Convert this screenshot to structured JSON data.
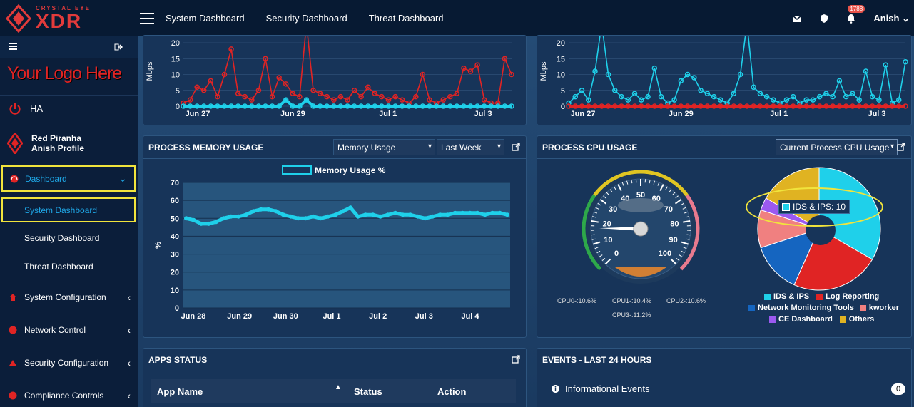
{
  "header": {
    "brand_small": "CRYSTAL EYE",
    "brand_big": "XDR",
    "nav": [
      "System Dashboard",
      "Security Dashboard",
      "Threat Dashboard"
    ],
    "notif_count": "1788",
    "user": "Anish"
  },
  "sidebar": {
    "logo_text": "Your Logo Here",
    "ha": "HA",
    "profile_name": "Red Piranha",
    "profile_sub": "Anish Profile",
    "items": [
      {
        "label": "Dashboard"
      },
      {
        "label": "System Dashboard"
      },
      {
        "label": "Security Dashboard"
      },
      {
        "label": "Threat Dashboard"
      },
      {
        "label": "System Configuration"
      },
      {
        "label": "Network Control"
      },
      {
        "label": "Security Configuration"
      },
      {
        "label": "Compliance Controls"
      }
    ]
  },
  "traffic_left": {
    "ylabel": "Mbps",
    "ticks": [
      "20",
      "15",
      "10",
      "5",
      "0"
    ],
    "xticks": [
      "Jun 27",
      "Jun 29",
      "Jul 1",
      "Jul 3"
    ]
  },
  "traffic_right": {
    "ylabel": "Mbps",
    "ticks": [
      "20",
      "15",
      "10",
      "5",
      "0"
    ],
    "xticks": [
      "Jun 27",
      "Jun 29",
      "Jul 1",
      "Jul 3"
    ]
  },
  "memory": {
    "title": "PROCESS MEMORY USAGE",
    "select1": "Memory Usage",
    "select2": "Last Week",
    "legend": "Memory Usage %"
  },
  "cpu": {
    "title": "PROCESS CPU USAGE",
    "select": "Current Process CPU Usage",
    "gauge_ticks": [
      "0",
      "10",
      "20",
      "30",
      "40",
      "50",
      "60",
      "70",
      "80",
      "90",
      "100"
    ],
    "gauge_value": 17,
    "cores": [
      "CPU0-:10.6%",
      "CPU1-:10.4%",
      "CPU2-:10.6%",
      "CPU3-:11.2%"
    ],
    "tooltip": "IDS & IPS: 10",
    "legend": [
      {
        "name": "IDS & IPS",
        "color": "#1fd0ea"
      },
      {
        "name": "Log Reporting",
        "color": "#e02424"
      },
      {
        "name": "Network Monitoring Tools",
        "color": "#1565c0"
      },
      {
        "name": "kworker",
        "color": "#f08080"
      },
      {
        "name": "CE Dashboard",
        "color": "#9b59f0"
      },
      {
        "name": "Others",
        "color": "#e0b322"
      }
    ]
  },
  "apps": {
    "title": "APPS STATUS",
    "columns": [
      "App Name",
      "Status",
      "Action"
    ]
  },
  "events": {
    "title": "EVENTS - LAST 24 HOURS",
    "rows": [
      {
        "label": "Informational Events",
        "count": "0"
      }
    ]
  },
  "chart_data": [
    {
      "type": "line",
      "ylabel": "Mbps",
      "x": [
        "Jun 27",
        "Jun 29",
        "Jul 1",
        "Jul 3"
      ],
      "ylim": [
        0,
        20
      ],
      "series": [
        {
          "color": "#e02424",
          "values": [
            1,
            2,
            6,
            5,
            8,
            3,
            10,
            18,
            4,
            3,
            2,
            5,
            15,
            3,
            9,
            7,
            4,
            3,
            30,
            5,
            4,
            3,
            2,
            3,
            2,
            5,
            3,
            6,
            4,
            3,
            2,
            3,
            2,
            1,
            3,
            10,
            2,
            1,
            2,
            3,
            4,
            12,
            11,
            13,
            2,
            1,
            1,
            15,
            10
          ]
        },
        {
          "color": "#1fd0ea",
          "values": [
            0,
            0,
            0,
            0,
            0,
            0,
            0,
            0,
            0,
            0,
            0,
            0,
            0,
            0,
            0,
            2,
            0,
            0,
            2,
            0,
            0,
            0,
            0,
            0,
            0,
            0,
            0,
            0,
            0,
            0,
            0,
            0,
            0,
            0,
            0,
            0,
            0,
            0,
            0,
            0,
            0,
            0,
            0,
            0,
            0,
            0,
            0,
            0,
            0
          ]
        }
      ]
    },
    {
      "type": "line",
      "ylabel": "Mbps",
      "x": [
        "Jun 27",
        "Jun 29",
        "Jul 1",
        "Jul 3"
      ],
      "ylim": [
        0,
        20
      ],
      "series": [
        {
          "color": "#1fd0ea",
          "values": [
            1,
            3,
            5,
            2,
            11,
            28,
            10,
            5,
            3,
            2,
            4,
            2,
            3,
            12,
            3,
            1,
            2,
            8,
            10,
            9,
            5,
            4,
            3,
            2,
            1,
            4,
            10,
            30,
            6,
            4,
            3,
            2,
            1,
            2,
            3,
            1,
            2,
            2,
            3,
            4,
            3,
            8,
            3,
            4,
            2,
            11,
            3,
            2,
            13,
            1,
            2,
            14
          ]
        },
        {
          "color": "#e02424",
          "values": [
            0,
            0,
            0,
            0,
            0,
            0,
            0,
            0,
            0,
            0,
            0,
            0,
            0,
            0,
            0,
            0,
            0,
            0,
            0,
            0,
            0,
            0,
            0,
            0,
            0,
            0,
            0,
            0,
            0,
            0,
            0,
            0,
            0,
            0,
            0,
            0,
            0,
            0,
            0,
            0,
            0,
            0,
            0,
            0,
            0,
            0,
            0,
            0,
            0,
            0,
            0,
            0
          ]
        }
      ]
    },
    {
      "type": "line",
      "title": "PROCESS MEMORY USAGE",
      "ylabel": "%",
      "x": [
        "Jun 28",
        "Jun 29",
        "Jun 30",
        "Jul 1",
        "Jul 2",
        "Jul 3",
        "Jul 4"
      ],
      "ylim": [
        0,
        70
      ],
      "series": [
        {
          "name": "Memory Usage %",
          "values": [
            50,
            49,
            47,
            47,
            48,
            50,
            51,
            51,
            52,
            54,
            55,
            55,
            54,
            52,
            51,
            50,
            50,
            51,
            50,
            51,
            52,
            54,
            56,
            51,
            52,
            52,
            51,
            52,
            53,
            52,
            52,
            51,
            50,
            51,
            52,
            52,
            53,
            53,
            53,
            53,
            52,
            53,
            53,
            52
          ]
        }
      ]
    },
    {
      "type": "pie",
      "categories": [
        "IDS & IPS",
        "Log Reporting",
        "Network Monitoring Tools",
        "kworker",
        "CE Dashboard",
        "Others"
      ],
      "values": [
        10,
        7,
        4,
        3,
        1,
        5
      ]
    }
  ]
}
